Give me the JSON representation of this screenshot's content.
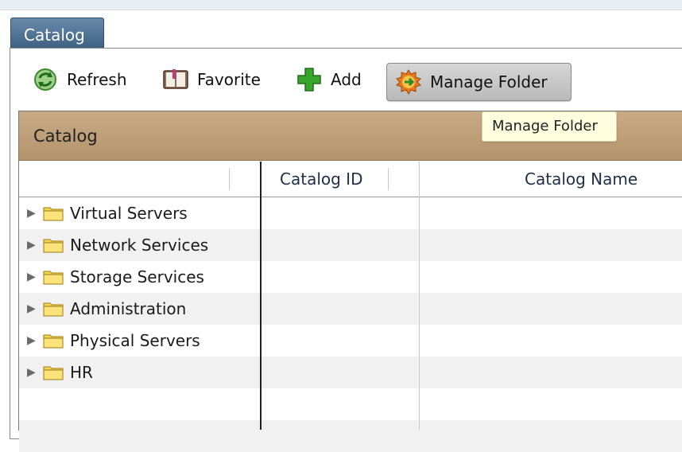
{
  "tab": {
    "label": "Catalog"
  },
  "toolbar": {
    "refresh_label": "Refresh",
    "favorite_label": "Favorite",
    "add_label": "Add",
    "manage_folder_label": "Manage Folder"
  },
  "tooltip": {
    "text": "Manage Folder"
  },
  "grid": {
    "title": "Catalog",
    "columns": [
      "",
      "Catalog ID",
      "Catalog Name"
    ],
    "folders": [
      {
        "label": "Virtual Servers"
      },
      {
        "label": "Network Services"
      },
      {
        "label": "Storage Services"
      },
      {
        "label": "Administration"
      },
      {
        "label": "Physical Servers"
      },
      {
        "label": "HR"
      }
    ]
  },
  "icons": {
    "refresh": "refresh-icon",
    "favorite": "book-icon",
    "add": "plus-icon",
    "manage": "gear-arrow-icon",
    "folder": "folder-icon",
    "expand": "expand-arrow-icon"
  },
  "colors": {
    "tab_bg": "#4f7092",
    "header_bg": "#bd9f78",
    "tooltip_bg": "#ffffe0",
    "add_green": "#3aa52e"
  }
}
